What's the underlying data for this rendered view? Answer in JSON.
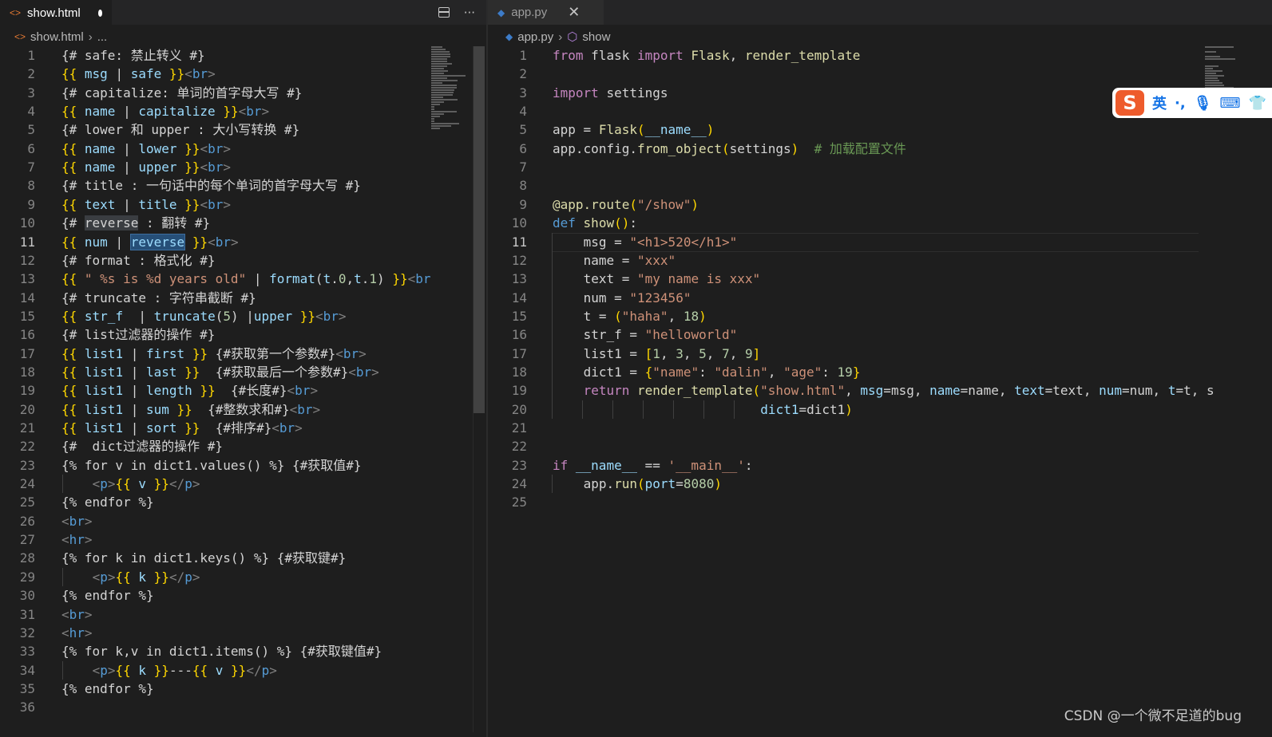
{
  "left_editor": {
    "tab": {
      "title": "show.html",
      "icon": "<>",
      "dirty": true
    },
    "actions": {
      "split": "split-editor-icon",
      "more": "···"
    },
    "breadcrumb": {
      "file": "show.html",
      "tail": "..."
    },
    "lines": [
      {
        "n": "1",
        "text": "{# safe: 禁止转义 #}"
      },
      {
        "n": "2",
        "text": "{{ msg | safe }}<br>"
      },
      {
        "n": "3",
        "text": "{# capitalize: 单词的首字母大写 #}"
      },
      {
        "n": "4",
        "text": "{{ name | capitalize }}<br>"
      },
      {
        "n": "5",
        "text": "{# lower 和 upper : 大小写转换 #}"
      },
      {
        "n": "6",
        "text": "{{ name | lower }}<br>"
      },
      {
        "n": "7",
        "text": "{{ name | upper }}<br>"
      },
      {
        "n": "8",
        "text": "{# title : 一句话中的每个单词的首字母大写 #}"
      },
      {
        "n": "9",
        "text": "{{ text | title }}<br>"
      },
      {
        "n": "10",
        "text": "{# reverse : 翻转 #}"
      },
      {
        "n": "11",
        "text": "{{ num | reverse }}<br>"
      },
      {
        "n": "12",
        "text": "{# format : 格式化 #}"
      },
      {
        "n": "13",
        "text": "{{ \" %s is %d years old\" | format(t.0,t.1) }}<br"
      },
      {
        "n": "14",
        "text": "{# truncate : 字符串截断 #}"
      },
      {
        "n": "15",
        "text": "{{ str_f  | truncate(5) |upper }}<br>"
      },
      {
        "n": "16",
        "text": "{# list过滤器的操作 #}"
      },
      {
        "n": "17",
        "text": "{{ list1 | first }} {#获取第一个参数#}<br>"
      },
      {
        "n": "18",
        "text": "{{ list1 | last }}  {#获取最后一个参数#}<br>"
      },
      {
        "n": "19",
        "text": "{{ list1 | length }}  {#长度#}<br>"
      },
      {
        "n": "20",
        "text": "{{ list1 | sum }}  {#整数求和#}<br>"
      },
      {
        "n": "21",
        "text": "{{ list1 | sort }}  {#排序#}<br>"
      },
      {
        "n": "22",
        "text": "{#  dict过滤器的操作 #}"
      },
      {
        "n": "23",
        "text": "{% for v in dict1.values() %} {#获取值#}"
      },
      {
        "n": "24",
        "text": "    <p>{{ v }}</p>"
      },
      {
        "n": "25",
        "text": "{% endfor %}"
      },
      {
        "n": "26",
        "text": "<br>"
      },
      {
        "n": "27",
        "text": "<hr>"
      },
      {
        "n": "28",
        "text": "{% for k in dict1.keys() %} {#获取键#}"
      },
      {
        "n": "29",
        "text": "    <p>{{ k }}</p>"
      },
      {
        "n": "30",
        "text": "{% endfor %}"
      },
      {
        "n": "31",
        "text": "<br>"
      },
      {
        "n": "32",
        "text": "<hr>"
      },
      {
        "n": "33",
        "text": "{% for k,v in dict1.items() %} {#获取键值#}"
      },
      {
        "n": "34",
        "text": "    <p>{{ k }}---{{ v }}</p>"
      },
      {
        "n": "35",
        "text": "{% endfor %}"
      },
      {
        "n": "36",
        "text": ""
      }
    ],
    "current_line": "11"
  },
  "right_editor": {
    "tab": {
      "title": "app.py",
      "icon": "python-icon",
      "close": "✕"
    },
    "breadcrumb": {
      "file": "app.py",
      "symbol": "show"
    },
    "lines": [
      {
        "n": "1",
        "text": "from flask import Flask, render_template"
      },
      {
        "n": "2",
        "text": ""
      },
      {
        "n": "3",
        "text": "import settings"
      },
      {
        "n": "4",
        "text": ""
      },
      {
        "n": "5",
        "text": "app = Flask(__name__)"
      },
      {
        "n": "6",
        "text": "app.config.from_object(settings)  # 加载配置文件"
      },
      {
        "n": "7",
        "text": ""
      },
      {
        "n": "8",
        "text": ""
      },
      {
        "n": "9",
        "text": "@app.route(\"/show\")"
      },
      {
        "n": "10",
        "text": "def show():"
      },
      {
        "n": "11",
        "text": "    msg = \"<h1>520</h1>\""
      },
      {
        "n": "12",
        "text": "    name = \"xxx\""
      },
      {
        "n": "13",
        "text": "    text = \"my name is xxx\""
      },
      {
        "n": "14",
        "text": "    num = \"123456\""
      },
      {
        "n": "15",
        "text": "    t = (\"haha\", 18)"
      },
      {
        "n": "16",
        "text": "    str_f = \"helloworld\""
      },
      {
        "n": "17",
        "text": "    list1 = [1, 3, 5, 7, 9]"
      },
      {
        "n": "18",
        "text": "    dict1 = {\"name\": \"dalin\", \"age\": 19}"
      },
      {
        "n": "19",
        "text": "    return render_template(\"show.html\", msg=msg, name=name, text=text, num=num, t=t, s"
      },
      {
        "n": "20",
        "text": "                           dict1=dict1)"
      },
      {
        "n": "21",
        "text": ""
      },
      {
        "n": "22",
        "text": ""
      },
      {
        "n": "23",
        "text": "if __name__ == '__main__':"
      },
      {
        "n": "24",
        "text": "    app.run(port=8080)"
      },
      {
        "n": "25",
        "text": ""
      }
    ],
    "current_line": "11"
  },
  "ime_toolbar": {
    "logo": "S",
    "mode": "英",
    "punct": "·,",
    "mic": "mic-icon",
    "keyboard": "keyboard-icon",
    "shirt": "skin-icon"
  },
  "watermark": "CSDN @一个微不足道的bug",
  "colors": {
    "background": "#1e1e1e",
    "tag": "#569cd6",
    "brace": "#ffd700",
    "variable": "#9cdcfe",
    "string": "#ce9178",
    "keyword": "#c586c0",
    "function": "#dcdcaa",
    "number": "#b5cea8",
    "comment": "#6a9955"
  }
}
